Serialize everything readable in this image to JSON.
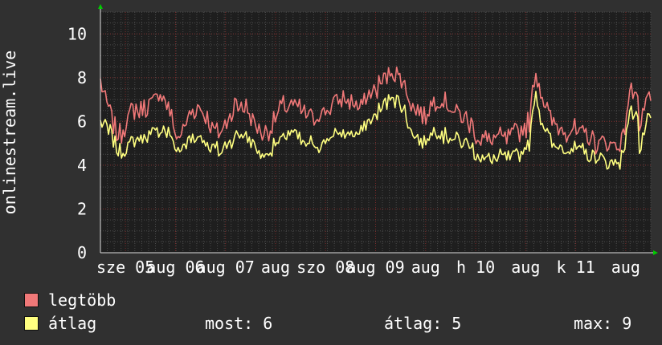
{
  "chart_data": {
    "type": "line",
    "ylabel": "onlinestream.live",
    "ylim": [
      0,
      11
    ],
    "yticks": [
      0,
      2,
      4,
      6,
      8,
      10
    ],
    "grid": true,
    "x_tick_labels": [
      "sze 05",
      "aug 06",
      "aug 07",
      "aug",
      "szo 08",
      "aug 09",
      "aug",
      "h 10",
      "aug",
      "k 11",
      "aug"
    ],
    "colors": {
      "background": "#303030",
      "plot_background": "#1e1e1e",
      "grid_minor": "#4a4a4a",
      "grid_major": "#7a2a2a",
      "legtobb": "#f07878",
      "atlag": "#ffff80",
      "axis_arrow": "#00cc00"
    },
    "series": [
      {
        "name": "legtöbb",
        "anchors": [
          [
            0.0,
            7.8
          ],
          [
            0.01,
            6.8
          ],
          [
            0.02,
            6.3
          ],
          [
            0.03,
            5.2
          ],
          [
            0.04,
            5.6
          ],
          [
            0.06,
            6.6
          ],
          [
            0.08,
            6.6
          ],
          [
            0.1,
            7.0
          ],
          [
            0.11,
            7.5
          ],
          [
            0.125,
            6.4
          ],
          [
            0.14,
            5.2
          ],
          [
            0.16,
            6.2
          ],
          [
            0.18,
            6.8
          ],
          [
            0.2,
            5.8
          ],
          [
            0.22,
            5.6
          ],
          [
            0.24,
            6.6
          ],
          [
            0.26,
            6.8
          ],
          [
            0.28,
            5.8
          ],
          [
            0.3,
            5.4
          ],
          [
            0.33,
            6.6
          ],
          [
            0.35,
            6.8
          ],
          [
            0.37,
            6.3
          ],
          [
            0.39,
            6.2
          ],
          [
            0.41,
            6.6
          ],
          [
            0.43,
            7.0
          ],
          [
            0.45,
            6.9
          ],
          [
            0.47,
            6.7
          ],
          [
            0.49,
            7.2
          ],
          [
            0.51,
            7.7
          ],
          [
            0.53,
            8.4
          ],
          [
            0.55,
            7.8
          ],
          [
            0.57,
            6.6
          ],
          [
            0.59,
            6.3
          ],
          [
            0.61,
            7.1
          ],
          [
            0.63,
            6.9
          ],
          [
            0.65,
            6.3
          ],
          [
            0.67,
            6.0
          ],
          [
            0.69,
            5.2
          ],
          [
            0.71,
            5.1
          ],
          [
            0.73,
            5.3
          ],
          [
            0.75,
            5.3
          ],
          [
            0.78,
            6.0
          ],
          [
            0.79,
            8.5
          ],
          [
            0.8,
            7.5
          ],
          [
            0.82,
            6.0
          ],
          [
            0.84,
            5.6
          ],
          [
            0.86,
            5.6
          ],
          [
            0.88,
            5.4
          ],
          [
            0.9,
            5.1
          ],
          [
            0.92,
            5.0
          ],
          [
            0.94,
            5.0
          ],
          [
            0.95,
            5.2
          ],
          [
            0.96,
            7.3
          ],
          [
            0.975,
            7.7
          ],
          [
            0.98,
            5.4
          ],
          [
            0.99,
            6.9
          ],
          [
            1.0,
            6.9
          ]
        ]
      },
      {
        "name": "átlag",
        "anchors": [
          [
            0.0,
            5.9
          ],
          [
            0.01,
            5.7
          ],
          [
            0.02,
            5.4
          ],
          [
            0.03,
            4.8
          ],
          [
            0.04,
            4.5
          ],
          [
            0.06,
            5.2
          ],
          [
            0.08,
            5.3
          ],
          [
            0.1,
            5.4
          ],
          [
            0.11,
            5.7
          ],
          [
            0.125,
            5.4
          ],
          [
            0.14,
            4.6
          ],
          [
            0.16,
            5.1
          ],
          [
            0.18,
            5.4
          ],
          [
            0.2,
            4.9
          ],
          [
            0.22,
            4.6
          ],
          [
            0.24,
            5.3
          ],
          [
            0.26,
            5.4
          ],
          [
            0.28,
            4.8
          ],
          [
            0.3,
            4.4
          ],
          [
            0.33,
            5.3
          ],
          [
            0.35,
            5.5
          ],
          [
            0.37,
            5.0
          ],
          [
            0.39,
            4.9
          ],
          [
            0.41,
            5.2
          ],
          [
            0.43,
            5.4
          ],
          [
            0.45,
            5.5
          ],
          [
            0.47,
            5.5
          ],
          [
            0.49,
            6.0
          ],
          [
            0.51,
            6.6
          ],
          [
            0.53,
            7.2
          ],
          [
            0.55,
            6.6
          ],
          [
            0.57,
            5.3
          ],
          [
            0.59,
            5.1
          ],
          [
            0.61,
            5.6
          ],
          [
            0.63,
            5.3
          ],
          [
            0.65,
            5.1
          ],
          [
            0.67,
            4.9
          ],
          [
            0.69,
            4.3
          ],
          [
            0.71,
            4.2
          ],
          [
            0.73,
            4.4
          ],
          [
            0.75,
            4.3
          ],
          [
            0.78,
            5.0
          ],
          [
            0.79,
            7.4
          ],
          [
            0.8,
            6.2
          ],
          [
            0.82,
            5.0
          ],
          [
            0.84,
            4.8
          ],
          [
            0.86,
            4.7
          ],
          [
            0.88,
            4.6
          ],
          [
            0.9,
            4.3
          ],
          [
            0.92,
            4.1
          ],
          [
            0.94,
            4.2
          ],
          [
            0.95,
            4.4
          ],
          [
            0.96,
            6.4
          ],
          [
            0.975,
            6.6
          ],
          [
            0.98,
            4.4
          ],
          [
            0.99,
            5.9
          ],
          [
            1.0,
            5.9
          ]
        ]
      }
    ]
  },
  "legend": [
    {
      "label": "legtöbb",
      "color": "#f07878"
    },
    {
      "label": "átlag",
      "color": "#ffff80"
    }
  ],
  "stats": {
    "most": "most: 6",
    "atlag": "átlag: 5",
    "max": "max: 9"
  }
}
